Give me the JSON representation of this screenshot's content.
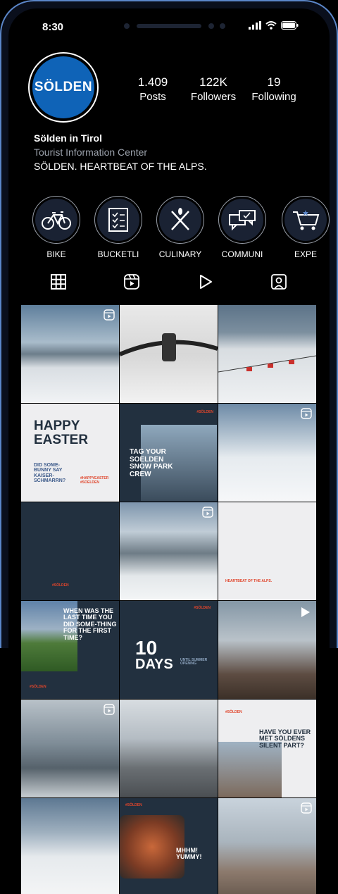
{
  "status_bar": {
    "time": "8:30"
  },
  "profile": {
    "logo_text": "SÖLDEN",
    "stats": [
      {
        "value": "1.409",
        "label": "Posts"
      },
      {
        "value": "122K",
        "label": "Followers"
      },
      {
        "value": "19",
        "label": "Following"
      }
    ],
    "name": "Sölden in Tirol",
    "category": "Tourist Information Center",
    "bio": "SÖLDEN. HEARTBEAT OF THE ALPS."
  },
  "highlights": [
    {
      "label": "BIKE",
      "icon": "bike-icon"
    },
    {
      "label": "BUCKETLI",
      "icon": "checklist-icon"
    },
    {
      "label": "CULINARY",
      "icon": "cutlery-icon"
    },
    {
      "label": "COMMUNI",
      "icon": "chat-icon"
    },
    {
      "label": "EXPE",
      "icon": "cart-icon"
    }
  ],
  "tabs": [
    "grid-icon",
    "reels-icon",
    "video-icon",
    "tagged-icon"
  ],
  "posts": {
    "happy_easter": {
      "title": "HAPPY EASTER",
      "sub": "DID SOME-BUNNY SAY KAISER-SCHMARRN?",
      "tag1": "#HAPPYEASTER",
      "tag2": "#SOELDEN"
    },
    "snowpark": {
      "tag": "#SÖLDEN",
      "text": "TAG YOUR SOELDEN SNOW PARK CREW"
    },
    "hashtag_solden": "#SÖLDEN",
    "heartbeat": "HEARTBEAT OF THE ALPS.",
    "when_was": {
      "text": "WHEN WAS THE LAST TIME YOU DID SOME-THING FOR THE FIRST TIME?",
      "tag": "#SÖLDEN"
    },
    "ten_days": {
      "tag": "#SÖLDEN",
      "num": "10",
      "days": "DAYS",
      "sub": "UNTIL SUMMER OPENING"
    },
    "silent_part": {
      "tag": "#SÖLDEN",
      "text": "HAVE YOU EVER MET SÖLDENS SILENT PART?"
    },
    "mhhm": {
      "tag": "#SÖLDEN",
      "text": "MHHM! YUMMY!"
    }
  },
  "colors": {
    "brand_blue": "#0f63b7",
    "navy": "#22303f",
    "accent_red": "#e0452b"
  }
}
